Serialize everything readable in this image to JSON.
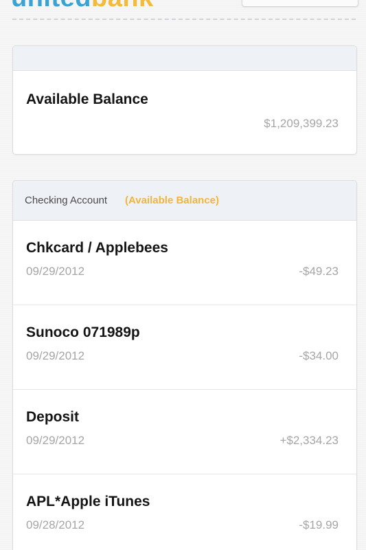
{
  "header": {
    "logo_part1": "united",
    "logo_part2": "bank",
    "brand_colors": {
      "blue": "#3aa3d3",
      "yellow": "#f2bb3a"
    }
  },
  "balance_card": {
    "title": "Available Balance",
    "amount": "$1,209,399.23"
  },
  "checking_card": {
    "account_label": "Checking Account",
    "balance_label": "(Available Balance)",
    "accent_color": "#f0b53b",
    "transactions": [
      {
        "name": "Chkcard / Applebees",
        "date": "09/29/2012",
        "amount": "-$49.23"
      },
      {
        "name": "Sunoco 071989p",
        "date": "09/29/2012",
        "amount": "-$34.00"
      },
      {
        "name": "Deposit",
        "date": "09/29/2012",
        "amount": "+$2,334.23"
      },
      {
        "name": "APL*Apple iTunes",
        "date": "09/28/2012",
        "amount": "-$19.99"
      }
    ]
  }
}
